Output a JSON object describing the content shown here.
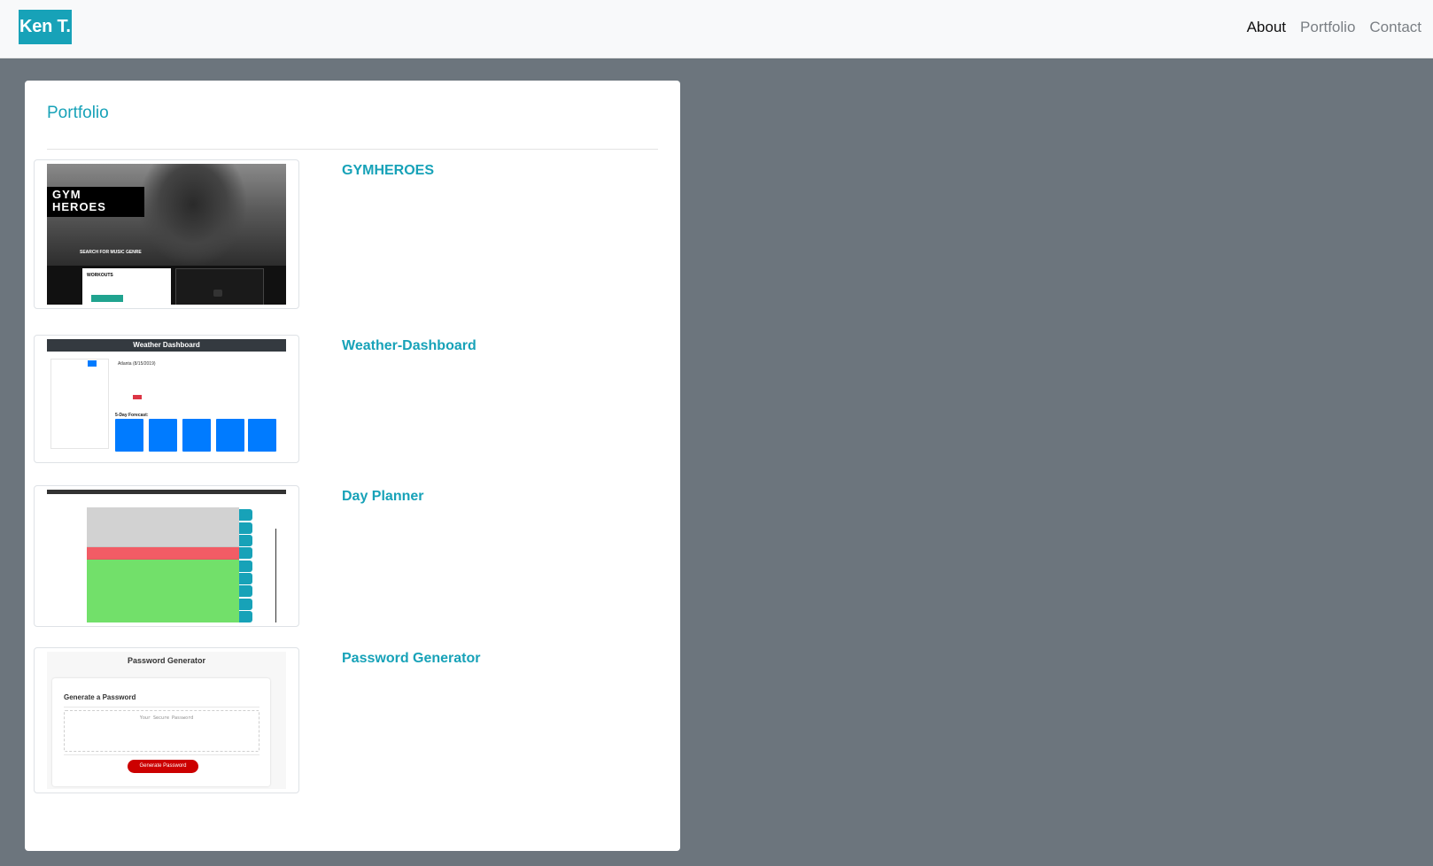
{
  "nav": {
    "brand": "Ken T.",
    "links": [
      {
        "label": "About",
        "active": true
      },
      {
        "label": "Portfolio",
        "active": false
      },
      {
        "label": "Contact",
        "active": false
      }
    ]
  },
  "card": {
    "title": "Portfolio"
  },
  "projects": [
    {
      "title": "GYMHEROES",
      "thumb": {
        "logo": "GYM HEROES",
        "search_heading": "SEARCH FOR MUSIC GENRE",
        "box_title": "WORKOUTS"
      }
    },
    {
      "title": "Weather-Dashboard",
      "thumb": {
        "header": "Weather Dashboard",
        "city": "Atlanta (8/15/2019)",
        "forecast_label": "5-Day Forecast:"
      }
    },
    {
      "title": "Day Planner",
      "thumb": {}
    },
    {
      "title": "Password Generator",
      "thumb": {
        "title": "Password Generator",
        "subtitle": "Generate a Password",
        "placeholder": "Your Secure Password",
        "button": "Generate Password"
      }
    }
  ],
  "colors": {
    "accent": "#17a2b8",
    "background": "#6c757d",
    "navbar": "#f8f9fa"
  }
}
